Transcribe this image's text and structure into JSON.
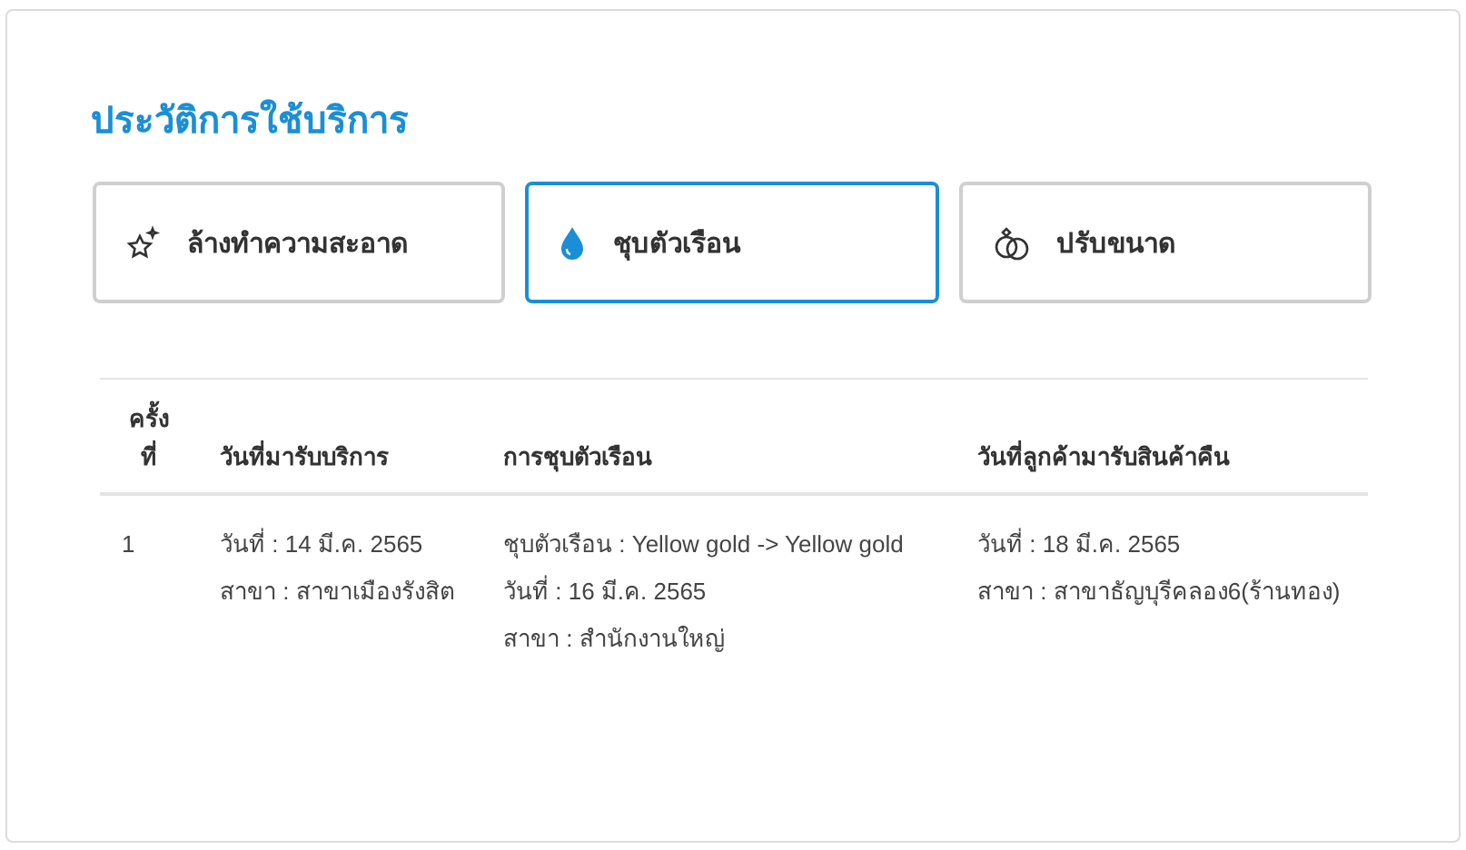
{
  "title": "ประวัติการใช้บริการ",
  "tabs": [
    {
      "kind": "sparkle",
      "label": "ล้างทำความสะอาด",
      "selected": false
    },
    {
      "kind": "drop",
      "label": "ชุบตัวเรือน",
      "selected": true
    },
    {
      "kind": "rings",
      "label": "ปรับขนาด",
      "selected": false
    }
  ],
  "table": {
    "columns": [
      "ครั้งที่",
      "วันที่มารับบริการ",
      "การชุบตัวเรือน",
      "วันที่ลูกค้ามารับสินค้าคืน"
    ],
    "rows": [
      [
        [
          "1"
        ],
        [
          "วันที่ : 14 มี.ค. 2565",
          "สาขา : สาขาเมืองรังสิต"
        ],
        [
          "ชุบตัวเรือน : Yellow gold -> Yellow gold",
          "วันที่ : 16 มี.ค. 2565",
          "สาขา : สำนักงานใหญ่"
        ],
        [
          "วันที่ : 18 มี.ค. 2565",
          "สาขา : สาขาธัญบุรีคลอง6(ร้านทอง)"
        ]
      ]
    ]
  }
}
